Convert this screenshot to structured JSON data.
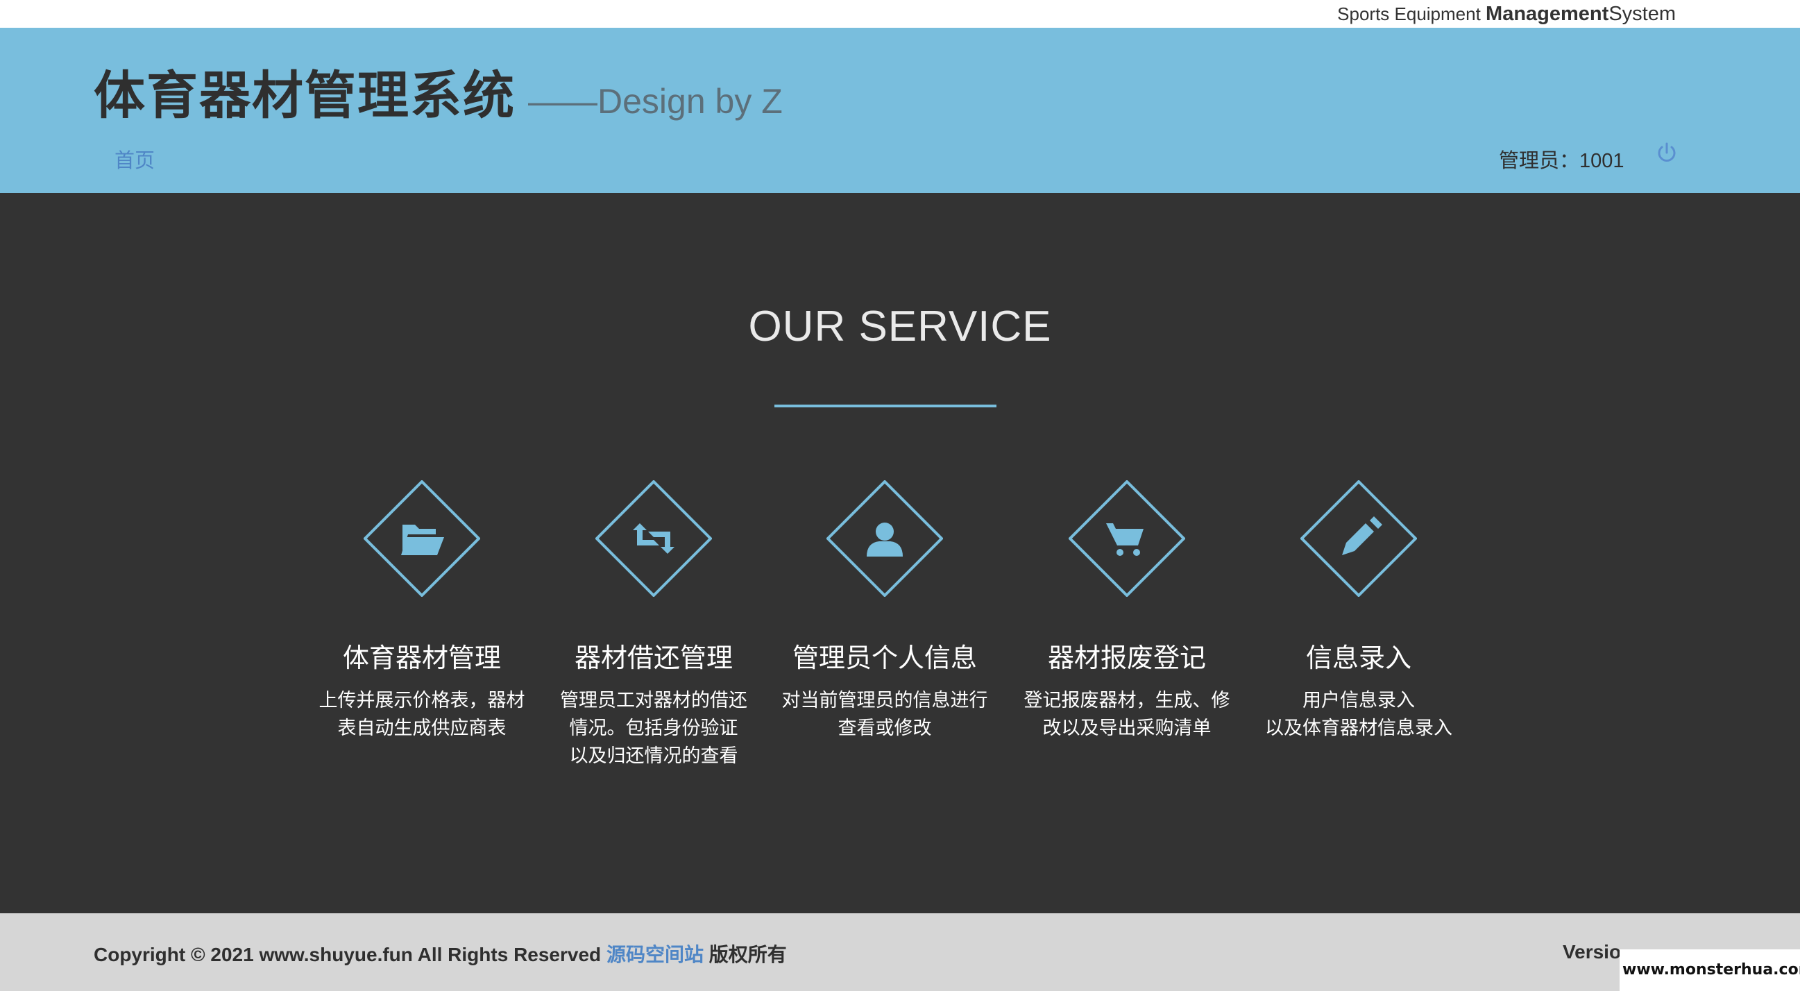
{
  "topbar": {
    "tagline_prefix": "Sports Equipment ",
    "tagline_bold": "Management",
    "tagline_suffix": "System"
  },
  "header": {
    "title_cn": "体育器材管理系统",
    "title_en": "——Design by Z",
    "nav_home": "首页",
    "admin_label": "管理员：1001",
    "power_icon": "power-icon"
  },
  "main": {
    "section_title": "OUR SERVICE",
    "services": [
      {
        "icon": "folder-open-icon",
        "name": "体育器材管理",
        "desc_lines": [
          "上传并展示价格表，器材",
          "表自动生成供应商表"
        ]
      },
      {
        "icon": "retweet-icon",
        "name": "器材借还管理",
        "desc_lines": [
          "管理员工对器材的借还",
          "情况。包括身份验证",
          "以及归还情况的查看"
        ]
      },
      {
        "icon": "user-icon",
        "name": "管理员个人信息",
        "desc_lines": [
          "对当前管理员的信息进行",
          "查看或修改"
        ]
      },
      {
        "icon": "shopping-cart-icon",
        "name": "器材报废登记",
        "desc_lines": [
          "登记报废器材，生成、修",
          "改以及导出采购清单"
        ]
      },
      {
        "icon": "pencil-icon",
        "name": "信息录入",
        "desc_lines": [
          "用户信息录入",
          "以及体育器材信息录入"
        ]
      }
    ]
  },
  "footer": {
    "copyright_prefix": "Copyright © 2021 www.shuyue.fun All Rights Reserved ",
    "copyright_link": "源码空间站",
    "copyright_suffix": " 版权所有",
    "version": "Versio"
  },
  "watermark": "www.monsterhua.com",
  "colors": {
    "header_bg": "#79bedd",
    "main_bg": "#333333",
    "accent": "#79bedd",
    "link": "#4f86c6",
    "footer_bg": "#d6d6d6"
  }
}
